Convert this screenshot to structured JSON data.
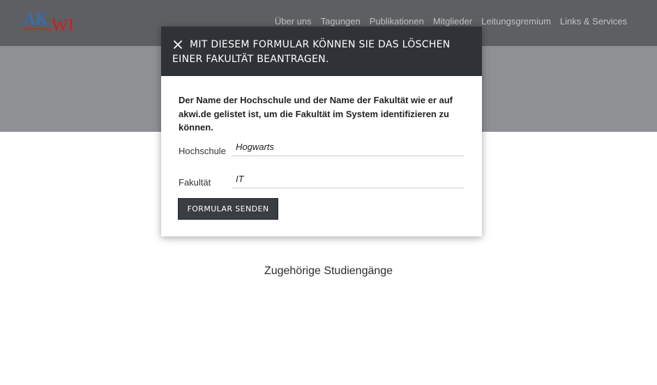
{
  "logo": {
    "part1": "AK",
    "part2": "WI"
  },
  "nav": {
    "items": [
      "Über uns",
      "Tagungen",
      "Publikationen",
      "Mitglieder",
      "Leitungsgremium",
      "Links & Services"
    ]
  },
  "page": {
    "subheading": "Zugehörige Studiengänge"
  },
  "modal": {
    "close_icon": "close-icon",
    "title": "MIT DIESEM FORMULAR KÖNNEN SIE DAS LÖSCHEN EINER FAKULTÄT BEANTRAGEN.",
    "description": "Der Name der Hochschule und der Name der Fakultät wie er auf akwi.de gelistet ist, um die Fakultät im System identifizieren zu können.",
    "fields": [
      {
        "label": "Hochschule",
        "value": "Hogwarts"
      },
      {
        "label": "Fakultät",
        "value": "IT"
      }
    ],
    "submit_label": "FORMULAR SENDEN"
  },
  "colors": {
    "topbar": "#5d5f62",
    "hero": "#8e9094",
    "modal_header": "#2f3338",
    "logo_blue": "#2b72c8",
    "logo_red": "#d01c1c"
  }
}
